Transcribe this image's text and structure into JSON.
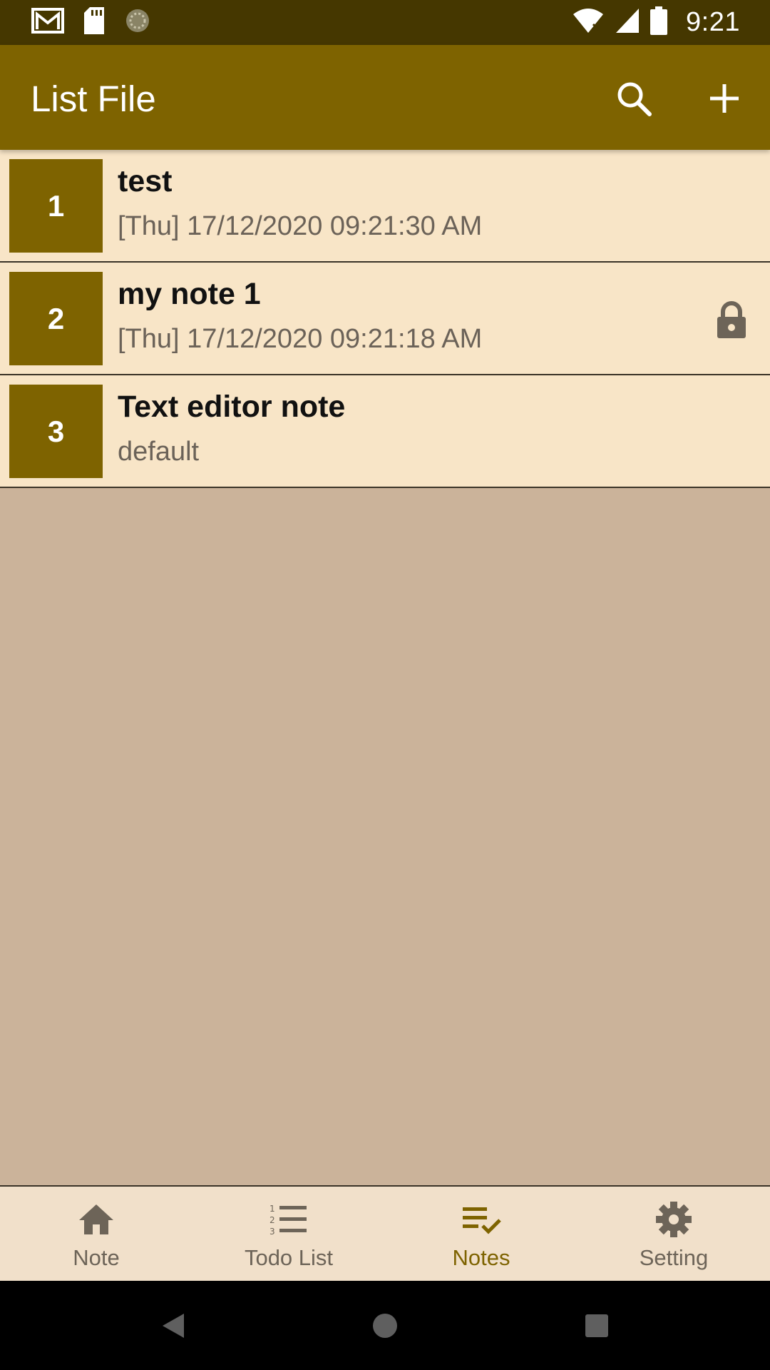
{
  "status_bar": {
    "time": "9:21",
    "icons_left": [
      "gmail-icon",
      "sd-card-icon",
      "sync-icon"
    ],
    "icons_right": [
      "wifi-icon",
      "signal-icon",
      "battery-icon"
    ]
  },
  "app_bar": {
    "title": "List File",
    "actions": [
      "search-icon",
      "add-icon"
    ]
  },
  "files": [
    {
      "number": "1",
      "title": "test",
      "subtitle": "[Thu] 17/12/2020 09:21:30 AM",
      "locked": false
    },
    {
      "number": "2",
      "title": "my note 1",
      "subtitle": "[Thu] 17/12/2020 09:21:18 AM",
      "locked": true
    },
    {
      "number": "3",
      "title": "Text editor note",
      "subtitle": "default",
      "locked": false
    }
  ],
  "bottom_nav": {
    "items": [
      {
        "label": "Note",
        "icon": "home-icon",
        "active": false
      },
      {
        "label": "Todo List",
        "icon": "numbered-list-icon",
        "active": false
      },
      {
        "label": "Notes",
        "icon": "playlist-check-icon",
        "active": true
      },
      {
        "label": "Setting",
        "icon": "gear-icon",
        "active": false
      }
    ]
  },
  "colors": {
    "status_bar": "#453700",
    "app_bar": "#7E6300",
    "row_background": "#F8E5C7",
    "content_background": "#CBB39A",
    "nav_background": "#F1E0CA",
    "active_nav": "#7E6300"
  }
}
